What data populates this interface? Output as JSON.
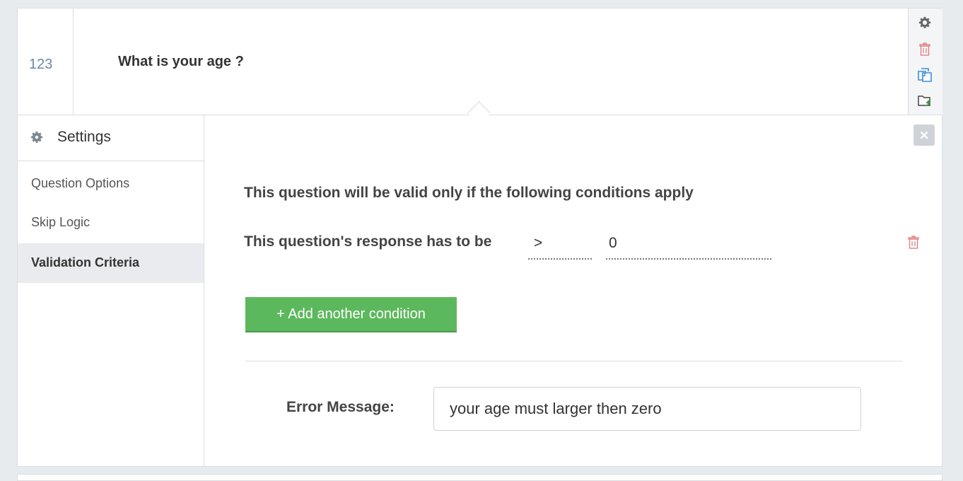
{
  "question": {
    "number": "123",
    "text": "What is your age ?",
    "actions": [
      {
        "icon": "gear-icon",
        "color": "#6b6b6b"
      },
      {
        "icon": "trash-icon",
        "color": "#e07a7a"
      },
      {
        "icon": "copy-icon",
        "color": "#3b8fd6"
      },
      {
        "icon": "move-icon",
        "color": "#444444"
      }
    ]
  },
  "sidebar": {
    "title": "Settings",
    "items": [
      {
        "label": "Question Options",
        "active": false
      },
      {
        "label": "Skip Logic",
        "active": false
      },
      {
        "label": "Validation Criteria",
        "active": true
      }
    ]
  },
  "validation": {
    "title": "This question will be valid only if the following conditions apply",
    "condition_label": "This question's response has to be",
    "operator": ">",
    "value": "0",
    "add_button": "+ Add another condition",
    "error_label": "Error Message:",
    "error_message": "your age must larger then zero"
  },
  "colors": {
    "accent_green": "#5cb85c",
    "number_blue": "#6b8aa6",
    "delete_red": "#e07a7a"
  }
}
